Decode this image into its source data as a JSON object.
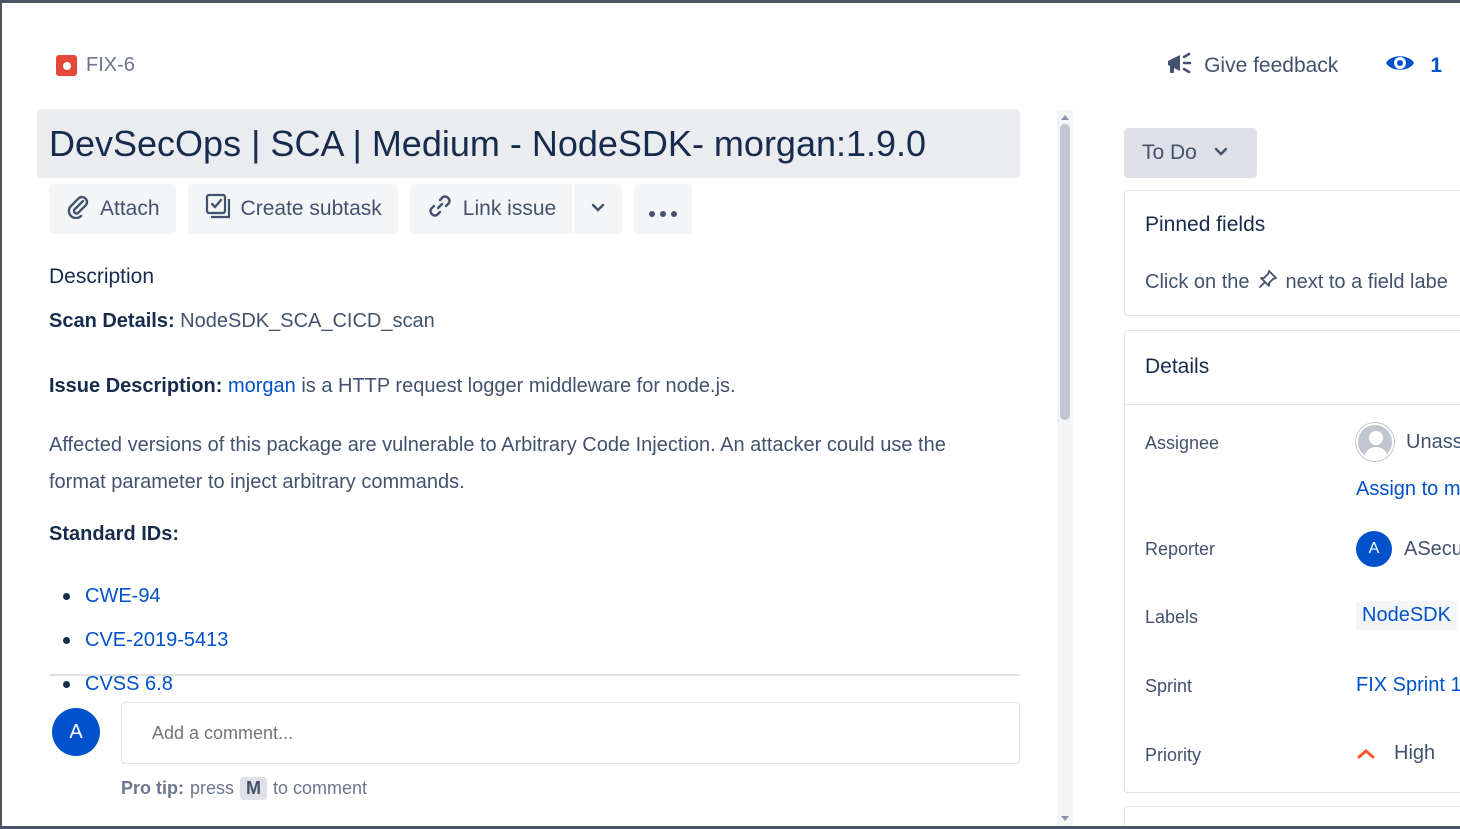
{
  "issue_key": "FIX-6",
  "header": {
    "feedback_label": "Give feedback",
    "watch_count": "1"
  },
  "title": "DevSecOps | SCA | Medium - NodeSDK- morgan:1.9.0",
  "toolbar": {
    "attach": "Attach",
    "create_subtask": "Create subtask",
    "link_issue": "Link issue"
  },
  "description": {
    "label": "Description",
    "scan_details_key": "Scan Details:",
    "scan_details_value": "NodeSDK_SCA_CICD_scan",
    "issue_desc_key": "Issue Description:",
    "issue_desc_link": "morgan",
    "issue_desc_rest": "is a HTTP request logger middleware for node.js.",
    "affected_text": "Affected versions of this package are vulnerable to Arbitrary Code Injection. An attacker could use the format parameter to inject arbitrary commands.",
    "standard_ids_label": "Standard IDs:",
    "standard_ids": [
      "CWE-94",
      "CVE-2019-5413",
      "CVSS 6.8"
    ]
  },
  "comment": {
    "avatar_letter": "A",
    "placeholder": "Add a comment...",
    "protip_label": "Pro tip:",
    "protip_press": "press",
    "protip_key": "M",
    "protip_rest": "to comment"
  },
  "status": "To Do",
  "pinned": {
    "title": "Pinned fields",
    "text_before": "Click on the",
    "text_after": "next to a field labe"
  },
  "details": {
    "title": "Details",
    "assignee_label": "Assignee",
    "assignee_value": "Unass",
    "assign_to_me": "Assign to m",
    "reporter_label": "Reporter",
    "reporter_avatar": "A",
    "reporter_value": "ASecu",
    "labels_label": "Labels",
    "labels_value": "NodeSDK",
    "sprint_label": "Sprint",
    "sprint_value": "FIX Sprint 1",
    "priority_label": "Priority",
    "priority_value": "High"
  },
  "colors": {
    "link": "#0052cc",
    "bug": "#e5493a",
    "priority_high": "#ff5630"
  }
}
